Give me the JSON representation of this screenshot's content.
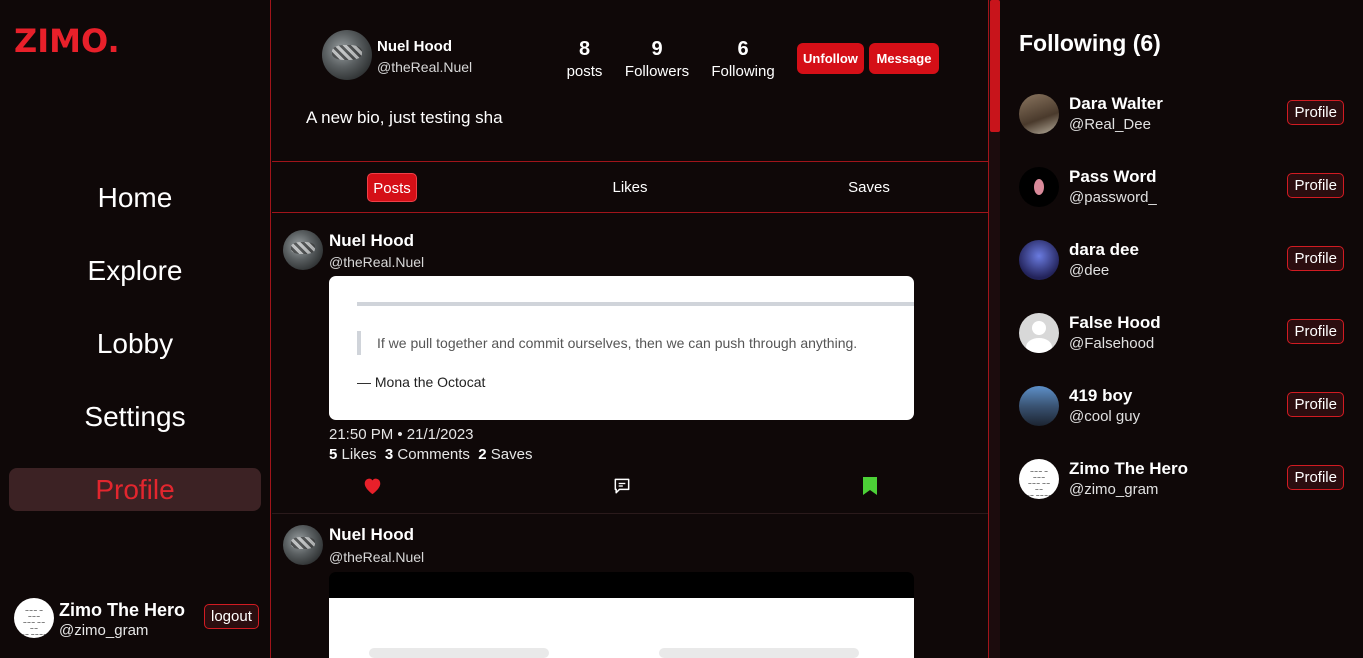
{
  "logo": "ZIMO.",
  "nav": [
    {
      "label": "Home",
      "active": false
    },
    {
      "label": "Explore",
      "active": false
    },
    {
      "label": "Lobby",
      "active": false
    },
    {
      "label": "Settings",
      "active": false
    },
    {
      "label": "Profile",
      "active": true
    }
  ],
  "current_user": {
    "name": "Zimo The Hero",
    "handle": "@zimo_gram",
    "logout_label": "logout"
  },
  "profile": {
    "name": "Nuel Hood",
    "handle": "@theReal.Nuel",
    "stats": [
      {
        "num": "8",
        "label": "posts"
      },
      {
        "num": "9",
        "label": "Followers"
      },
      {
        "num": "6",
        "label": "Following"
      }
    ],
    "unfollow_label": "Unfollow",
    "message_label": "Message",
    "bio": "A new bio, just testing sha"
  },
  "tabs": [
    {
      "label": "Posts",
      "active": true
    },
    {
      "label": "Likes",
      "active": false
    },
    {
      "label": "Saves",
      "active": false
    }
  ],
  "posts": [
    {
      "name": "Nuel Hood",
      "handle": "@theReal.Nuel",
      "quote": "If we pull together and commit ourselves, then we can push through anything.",
      "author": "— Mona the Octocat",
      "time": "21:50 PM • 21/1/2023",
      "likes": "5",
      "likes_label": "Likes",
      "comments": "3",
      "comments_label": "Comments",
      "saves": "2",
      "saves_label": "Saves"
    },
    {
      "name": "Nuel Hood",
      "handle": "@theReal.Nuel"
    }
  ],
  "following": {
    "title": "Following (6)",
    "profile_label": "Profile",
    "items": [
      {
        "name": "Dara Walter",
        "handle": "@Real_Dee"
      },
      {
        "name": "Pass Word",
        "handle": "@password_"
      },
      {
        "name": "dara dee",
        "handle": "@dee"
      },
      {
        "name": "False Hood",
        "handle": "@Falsehood"
      },
      {
        "name": "419 boy",
        "handle": "@cool guy"
      },
      {
        "name": "Zimo The Hero",
        "handle": "@zimo_gram"
      }
    ]
  },
  "colors": {
    "accent": "#d50f17",
    "background": "#0f0808",
    "like": "#e8202a",
    "save": "#4cd137"
  },
  "icons": {
    "like": "heart-icon",
    "comment": "comment-icon",
    "save": "bookmark-icon"
  }
}
